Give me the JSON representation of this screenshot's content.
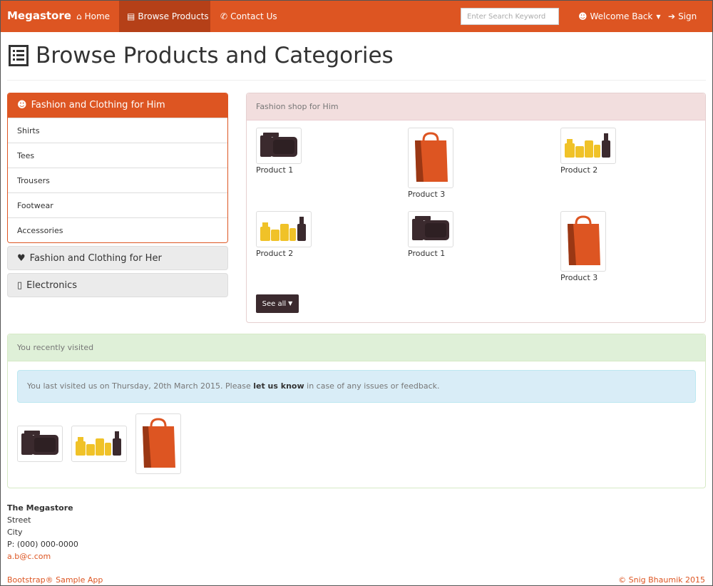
{
  "navbar": {
    "brand": "Megastore",
    "home": "Home",
    "browse": "Browse Products",
    "contact": "Contact Us",
    "search_placeholder": "Enter Search Keyword",
    "welcome": "Welcome Back",
    "signin": "Sign In",
    "color": "#dd5522",
    "active_color": "#b54018"
  },
  "page": {
    "title": "Browse Products and Categories"
  },
  "sidebar": {
    "open_category": "Fashion and Clothing for Him",
    "items": [
      "Shirts",
      "Tees",
      "Trousers",
      "Footwear",
      "Accessories"
    ],
    "closed_categories": [
      "Fashion and Clothing for Her",
      "Electronics"
    ]
  },
  "shop": {
    "heading": "Fashion shop for Him",
    "products": [
      {
        "name": "Product 1",
        "icon": "camera-bag-icon"
      },
      {
        "name": "Product 3",
        "icon": "shopping-bag-icon"
      },
      {
        "name": "Product 2",
        "icon": "bottles-icon"
      },
      {
        "name": "Product 2",
        "icon": "bottles-icon"
      },
      {
        "name": "Product 1",
        "icon": "camera-bag-icon"
      },
      {
        "name": "Product 3",
        "icon": "shopping-bag-icon"
      }
    ],
    "see_all": "See all"
  },
  "recent": {
    "heading": "You recently visited",
    "alert_prefix": "You last visited us on Thursday, 20th March 2015. Please ",
    "alert_link": "let us know",
    "alert_suffix": " in case of any issues or feedback."
  },
  "footer": {
    "company": "The Megastore",
    "street": "Street",
    "city": "City",
    "phone": "P: (000) 000-0000",
    "email": "a.b@c.com",
    "left": "Bootstrap® Sample App",
    "right": "© Snig Bhaumik 2015"
  }
}
